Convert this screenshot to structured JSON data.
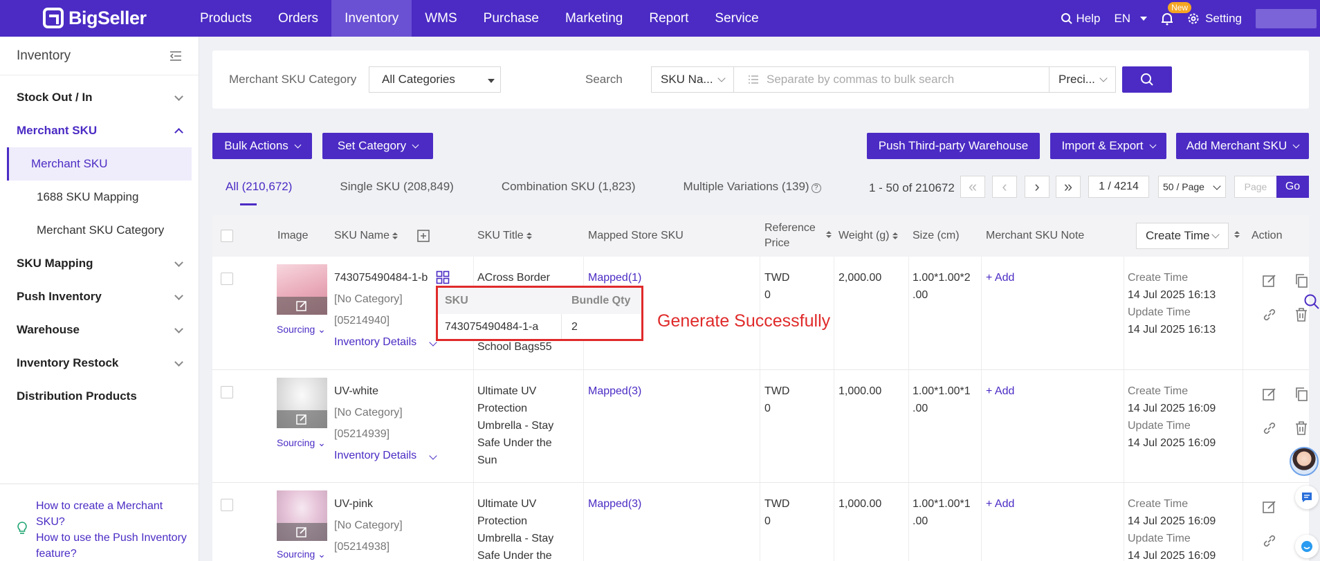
{
  "brand": "BigSeller",
  "nav": {
    "items": [
      "Products",
      "Orders",
      "Inventory",
      "WMS",
      "Purchase",
      "Marketing",
      "Report",
      "Service"
    ],
    "active": "Inventory",
    "help": "Help",
    "lang": "EN",
    "new_badge": "New",
    "setting": "Setting"
  },
  "sidebar": {
    "title": "Inventory",
    "groups": [
      {
        "label": "Stock Out / In"
      },
      {
        "label": "Merchant SKU",
        "open": true,
        "children": [
          "Merchant SKU",
          "1688 SKU Mapping",
          "Merchant SKU Category"
        ],
        "active_child": "Merchant SKU"
      },
      {
        "label": "SKU Mapping"
      },
      {
        "label": "Push Inventory"
      },
      {
        "label": "Warehouse"
      },
      {
        "label": "Inventory Restock"
      },
      {
        "label": "Distribution Products"
      }
    ],
    "help_links": [
      "How to create a Merchant SKU?",
      "How to use the Push Inventory feature?"
    ]
  },
  "filter": {
    "category_label": "Merchant SKU Category",
    "category_value": "All Categories",
    "search_label": "Search",
    "search_field": "SKU Na...",
    "search_placeholder": "Separate by commas to bulk search",
    "match_mode": "Preci..."
  },
  "actions": {
    "bulk": "Bulk Actions",
    "set_category": "Set Category",
    "push_third_party": "Push Third-party Warehouse",
    "import_export": "Import & Export",
    "add_sku": "Add Merchant SKU"
  },
  "tabs": [
    "All (210,672)",
    "Single SKU (208,849)",
    "Combination SKU (1,823)",
    "Multiple Variations (139)"
  ],
  "pager": {
    "range": "1 - 50 of 210672",
    "page": "1 / 4214",
    "per_page": "50 / Page",
    "page_placeholder": "Page",
    "go": "Go"
  },
  "table": {
    "headers": {
      "image": "Image",
      "sku_name": "SKU Name",
      "sku_title": "SKU Title",
      "mapped": "Mapped Store SKU",
      "ref_price_1": "Reference",
      "ref_price_2": "Price",
      "weight": "Weight (g)",
      "size": "Size (cm)",
      "note": "Merchant SKU Note",
      "create_time": "Create Time",
      "action": "Action"
    },
    "rows": [
      {
        "sku": "743075490484-1-b",
        "category": "[No Category]",
        "code": "[05214940]",
        "inv_details": "Inventory Details",
        "title_lines": [
          "ACross Border",
          "",
          "",
          "School Bags55"
        ],
        "mapped": "Mapped(1)",
        "currency": "TWD",
        "price": "0",
        "weight": "2,000.00",
        "size_lines": [
          "1.00*1.00*2",
          ".00"
        ],
        "note": "+ Add",
        "create_label": "Create Time",
        "create": "14 Jul 2025 16:13",
        "update_label": "Update Time",
        "update": "14 Jul 2025 16:13",
        "sourcing": "Sourcing"
      },
      {
        "sku": "UV-white",
        "category": "[No Category]",
        "code": "[05214939]",
        "inv_details": "Inventory Details",
        "title_lines": [
          "Ultimate UV",
          "Protection",
          "Umbrella - Stay",
          "Safe Under the",
          "Sun"
        ],
        "mapped": "Mapped(3)",
        "currency": "TWD",
        "price": "0",
        "weight": "1,000.00",
        "size_lines": [
          "1.00*1.00*1",
          ".00"
        ],
        "note": "+ Add",
        "create_label": "Create Time",
        "create": "14 Jul 2025 16:09",
        "update_label": "Update Time",
        "update": "14 Jul 2025 16:09",
        "sourcing": "Sourcing"
      },
      {
        "sku": "UV-pink",
        "category": "[No Category]",
        "code": "[05214938]",
        "inv_details": "",
        "title_lines": [
          "Ultimate UV",
          "Protection",
          "Umbrella - Stay",
          "Safe Under the"
        ],
        "mapped": "Mapped(3)",
        "currency": "TWD",
        "price": "0",
        "weight": "1,000.00",
        "size_lines": [
          "1.00*1.00*1",
          ".00"
        ],
        "note": "+ Add",
        "create_label": "Create Time",
        "create": "14 Jul 2025 16:09",
        "update_label": "Update Time",
        "update": "14 Jul 2025 16:09",
        "sourcing": "Sourcing"
      }
    ]
  },
  "bundle_popup": {
    "col_sku": "SKU",
    "col_qty": "Bundle Qty",
    "sku": "743075490484-1-a",
    "qty": "2"
  },
  "annotation": "Generate Successfully",
  "colors": {
    "brand": "#4b2bc4",
    "annotation": "#e02a2a"
  }
}
